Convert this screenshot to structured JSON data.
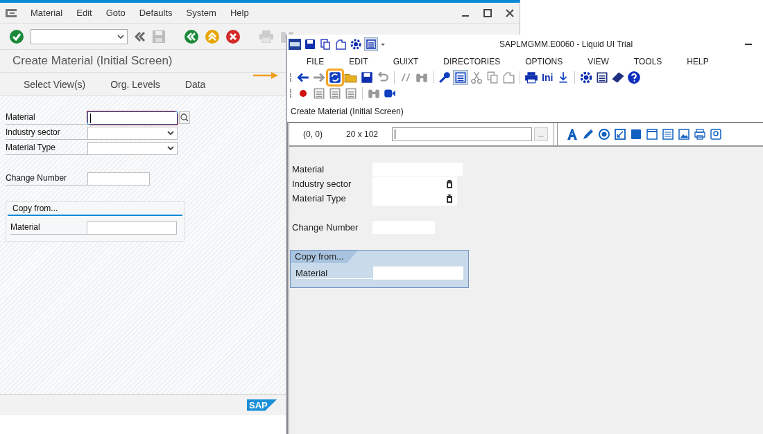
{
  "sap_window": {
    "menu": [
      "Material",
      "Edit",
      "Goto",
      "Defaults",
      "System",
      "Help"
    ],
    "screen_title": "Create Material (Initial Screen)",
    "app_toolbar": [
      "Select View(s)",
      "Org. Levels",
      "Data"
    ],
    "fields": [
      {
        "label": "Material",
        "kind": "input",
        "focused": true,
        "search_help": true
      },
      {
        "label": "Industry sector",
        "kind": "dropdown",
        "focused": false,
        "search_help": false
      },
      {
        "label": "Material Type",
        "kind": "dropdown",
        "focused": false,
        "search_help": false
      },
      {
        "label": "Change Number",
        "kind": "short",
        "focused": false,
        "search_help": false
      }
    ],
    "copy_from": {
      "title": "Copy from...",
      "fields": [
        {
          "label": "Material"
        }
      ]
    },
    "logo": "SAP"
  },
  "liquid_ui": {
    "title": "SAPLMGMM.E0060 - Liquid UI Trial",
    "menu": [
      "FILE",
      "EDIT",
      "GUIXT",
      "DIRECTORIES",
      "OPTIONS",
      "VIEW",
      "TOOLS",
      "HELP"
    ],
    "toolbar_text": "Ini",
    "screen_title": "Create Material (Initial Screen)",
    "designer": {
      "position": "(0, 0)",
      "size": "20 x 102",
      "browse": "..."
    },
    "fields": [
      {
        "label": "Material",
        "kind": "input"
      },
      {
        "label": "Industry sector",
        "kind": "dropdown"
      },
      {
        "label": "Material Type",
        "kind": "dropdown"
      },
      {
        "label": "Change Number",
        "kind": "short"
      }
    ],
    "copy_from": {
      "title": "Copy from...",
      "fields": [
        {
          "label": "Material"
        }
      ]
    }
  }
}
